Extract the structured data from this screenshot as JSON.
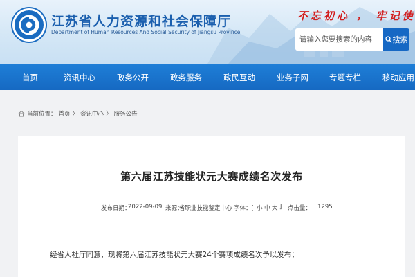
{
  "header": {
    "title": "江苏省人力资源和社会保障厅",
    "subtitle": "Department of Human Resources And Social Security of Jiangsu Province",
    "slogan": "不忘初心 ， 牢记使命",
    "emblem_icon": "ministry-emblem-icon",
    "search": {
      "placeholder": "请输入您要搜索的内容",
      "button_label": "搜索",
      "icon": "search-icon"
    },
    "colors": {
      "brand": "#1b5fae",
      "slogan": "#d21f1f",
      "nav": "#1669c2"
    }
  },
  "nav": {
    "items": [
      {
        "label": "首页"
      },
      {
        "label": "资讯中心"
      },
      {
        "label": "政务公开"
      },
      {
        "label": "政务服务"
      },
      {
        "label": "政民互动"
      },
      {
        "label": "业务子网"
      },
      {
        "label": "专题专栏"
      },
      {
        "label": "移动应用"
      }
    ]
  },
  "breadcrumb": {
    "icon": "home-icon",
    "prefix": "当前位置：",
    "items": [
      "首页",
      "资讯中心",
      "服务公告"
    ],
    "separator": "〉"
  },
  "article": {
    "title": "第六届江苏技能状元大赛成绩名次发布",
    "meta": {
      "date_label": "发布日期：",
      "date": "2022-09-09",
      "source_label": "来源：",
      "source": "省职业技能鉴定中心",
      "font_label": "字体：[",
      "font_small": "小",
      "font_medium": "中",
      "font_large": "大",
      "font_close": "]",
      "hits_label": "点击量：",
      "hits": "1295"
    },
    "body_first_line": "经省人社厅同意，现将第六届江苏技能状元大赛24个赛项成绩名次予以发布："
  }
}
